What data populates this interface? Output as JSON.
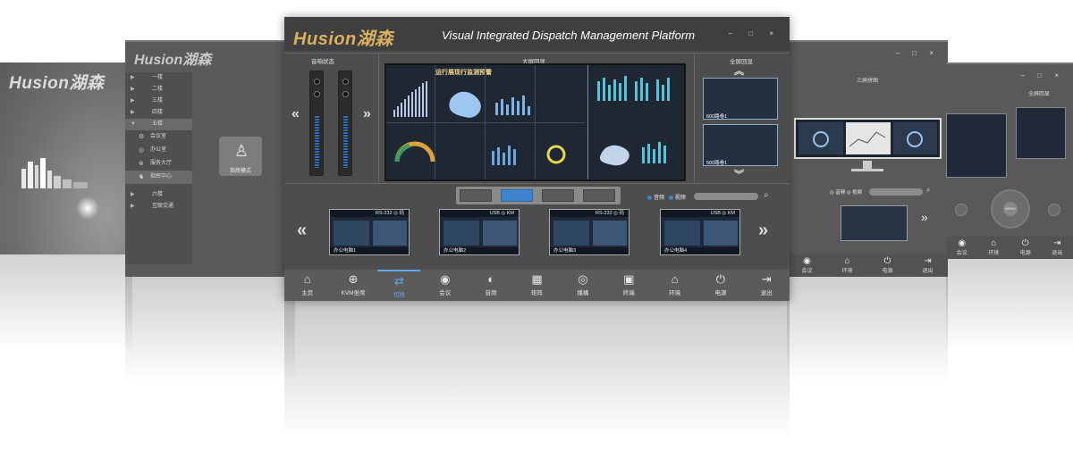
{
  "windows": {
    "far_left": {
      "brand": "Husion湖森"
    },
    "left": {
      "brand": "Husion湖森",
      "menu": [
        {
          "label": "一楼",
          "arrow": "▶"
        },
        {
          "label": "二楼",
          "arrow": "▶"
        },
        {
          "label": "三楼",
          "arrow": "▶"
        },
        {
          "label": "四楼",
          "arrow": "▶"
        },
        {
          "label": "五楼",
          "arrow": "▼"
        }
      ],
      "submenu": [
        {
          "label": "会议室",
          "icon": "⚙"
        },
        {
          "label": "办公室",
          "icon": "◎"
        },
        {
          "label": "服务大厅",
          "icon": "⊛"
        },
        {
          "label": "指挥中心",
          "icon": "♞"
        }
      ],
      "menu2": [
        {
          "label": "六楼",
          "arrow": "▶"
        },
        {
          "label": "互联交通",
          "arrow": "▶"
        }
      ],
      "mode_label": "指挥模式"
    },
    "main": {
      "brand": "Husion湖森",
      "title": "Visual Integrated Dispatch Management Platform",
      "window_controls": "– □ ×",
      "audio_panel_label": "音响状态",
      "wall_panel_label": "大屏回显",
      "wall_title": "运行展现行监测预警",
      "side_panel_label": "全屏回显",
      "side_caps": [
        "600路卷1",
        "500路卷1"
      ],
      "toggle_labels": [
        "音频",
        "视频"
      ],
      "sources": [
        {
          "header": "RS-232  ◎ 码",
          "footer": "办公电脑1"
        },
        {
          "header": "USB  ◎ KM",
          "footer": "办公电脑2"
        },
        {
          "header": "RS-232  ◎ 码",
          "footer": "办公电脑3"
        },
        {
          "header": "USB  ◎ KM",
          "footer": "办公电脑4"
        }
      ],
      "nav": [
        {
          "label": "主页",
          "icon": "⌂",
          "active": false
        },
        {
          "label": "KVM坐席",
          "icon": "⊕",
          "active": false
        },
        {
          "label": "切换",
          "icon": "⇄",
          "active": true
        },
        {
          "label": "会议",
          "icon": "◉",
          "active": false
        },
        {
          "label": "音频",
          "icon": "◐",
          "active": false
        },
        {
          "label": "矩阵",
          "icon": "▦",
          "active": false
        },
        {
          "label": "播播",
          "icon": "◎",
          "active": false
        },
        {
          "label": "终端",
          "icon": "▣",
          "active": false
        },
        {
          "label": "环境",
          "icon": "⌂",
          "active": false
        },
        {
          "label": "电源",
          "icon": "⏻",
          "active": false
        },
        {
          "label": "退出",
          "icon": "⇥",
          "active": false
        }
      ]
    },
    "right": {
      "window_controls": "– □ ×",
      "title": "三屏拼图",
      "toggle": "◎ 音频 ◎ 视频",
      "nav": [
        {
          "label": "会议",
          "icon": "◉"
        },
        {
          "label": "环境",
          "icon": "⌂"
        },
        {
          "label": "电源",
          "icon": "⏻"
        },
        {
          "label": "退出",
          "icon": "⇥"
        }
      ]
    },
    "far_right": {
      "window_controls": "– □ ×",
      "title": "全屏回显",
      "dpad_center": "MENU",
      "nav": [
        {
          "label": "会议",
          "icon": "◉"
        },
        {
          "label": "环境",
          "icon": "⌂"
        },
        {
          "label": "电源",
          "icon": "⏻"
        },
        {
          "label": "退出",
          "icon": "⇥"
        }
      ]
    }
  },
  "colors": {
    "brand_gold": "#d8b060",
    "accent_blue": "#5fa6ea",
    "panel_dark": "#4d4d4d"
  }
}
